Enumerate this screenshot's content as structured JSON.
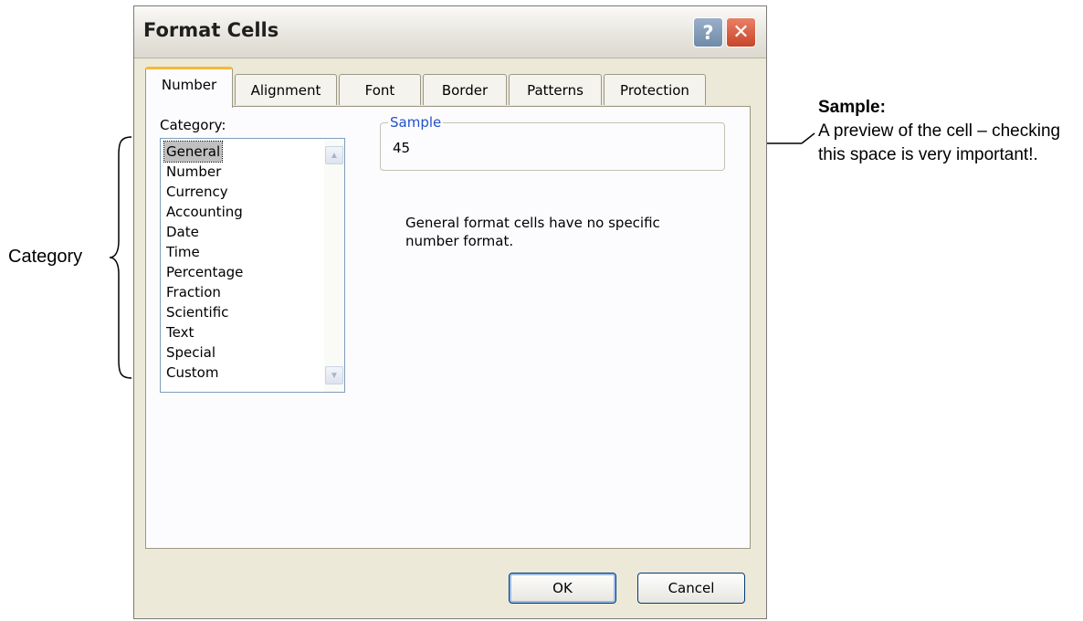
{
  "annotations": {
    "left_label": "Category",
    "right_title": "Sample:",
    "right_text": "A preview of the cell – checking this space is very important!."
  },
  "dialog": {
    "title": "Format Cells",
    "help_glyph": "?",
    "close_glyph": "✕",
    "tabs": [
      {
        "label": "Number",
        "active": true
      },
      {
        "label": "Alignment",
        "active": false
      },
      {
        "label": "Font",
        "active": false
      },
      {
        "label": "Border",
        "active": false
      },
      {
        "label": "Patterns",
        "active": false
      },
      {
        "label": "Protection",
        "active": false
      }
    ],
    "category_label": "Category:",
    "categories": [
      "General",
      "Number",
      "Currency",
      "Accounting",
      "Date",
      "Time",
      "Percentage",
      "Fraction",
      "Scientific",
      "Text",
      "Special",
      "Custom"
    ],
    "selected_category": "General",
    "sample_legend": "Sample",
    "sample_value": "45",
    "description": "General format cells have no specific number format.",
    "ok_label": "OK",
    "cancel_label": "Cancel"
  },
  "icons": {
    "help": "help-icon",
    "close": "close-icon",
    "scroll_up": "scroll-up-icon",
    "scroll_down": "scroll-down-icon"
  },
  "colors": {
    "dialog_bg": "#ece9d8",
    "active_tab_accent": "#f6b73a",
    "close_button": "#c8452a",
    "sample_legend": "#2251cc"
  }
}
